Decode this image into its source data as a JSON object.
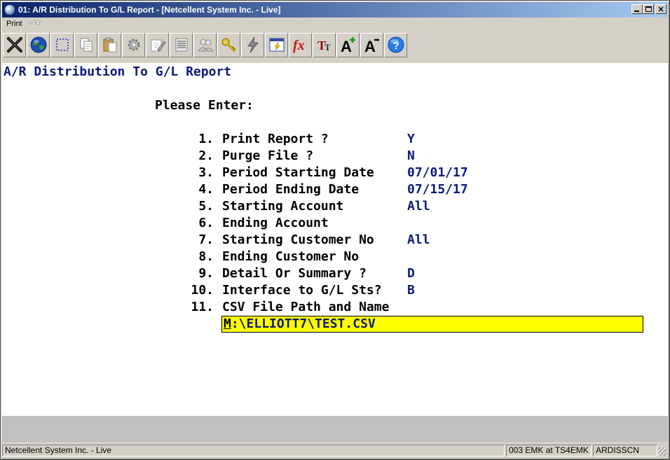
{
  "window": {
    "title": "01: A/R Distribution To G/L Report - [Netcellent System Inc. - Live]"
  },
  "menu": [
    {
      "label": "Print",
      "enabled": true
    },
    {
      "label": "eXit",
      "enabled": false
    }
  ],
  "toolbar": {
    "icons": [
      "close-x-icon",
      "globe-icon",
      "select-box-icon",
      "copy-icon",
      "paste-icon",
      "settings-gear-icon",
      "edit-icon",
      "list-icon",
      "users-icon",
      "key-icon",
      "lightning-icon",
      "calendar-icon",
      "function-icon",
      "font-size-icon",
      "increase-font-icon",
      "decrease-font-icon",
      "help-icon"
    ],
    "fx_label": "fx",
    "tt_label": "TT",
    "font_up_label": "A",
    "font_down_label": "A"
  },
  "screen": {
    "report_title": "A/R Distribution To G/L Report",
    "prompt_heading": "Please Enter:",
    "fields": [
      {
        "num": "1.",
        "label": "Print Report ?",
        "value": "Y"
      },
      {
        "num": "2.",
        "label": "Purge File ?",
        "value": "N"
      },
      {
        "num": "3.",
        "label": "Period Starting Date",
        "value": "07/01/17"
      },
      {
        "num": "4.",
        "label": "Period Ending Date",
        "value": "07/15/17"
      },
      {
        "num": "5.",
        "label": "Starting Account",
        "value": "All"
      },
      {
        "num": "6.",
        "label": "Ending Account",
        "value": ""
      },
      {
        "num": "7.",
        "label": "Starting Customer No",
        "value": "All"
      },
      {
        "num": "8.",
        "label": "Ending Customer No",
        "value": ""
      },
      {
        "num": "9.",
        "label": "Detail Or Summary ?",
        "value": "D"
      },
      {
        "num": "10.",
        "label": "Interface to G/L Sts?",
        "value": "B"
      },
      {
        "num": "11.",
        "label": "CSV File Path and Name",
        "value": ""
      }
    ],
    "csv_path_first": "M",
    "csv_path_rest": ":\\ELLIOTT7\\TEST.CSV"
  },
  "statusbar": {
    "company": "Netcellent System Inc. - Live",
    "session": "003 EMK at TS4EMK",
    "screen_id": "ARDISSCN"
  },
  "colors": {
    "title_blue": "#0a246a",
    "value_text": "#0d1a7a",
    "input_highlight": "#ffff00"
  }
}
